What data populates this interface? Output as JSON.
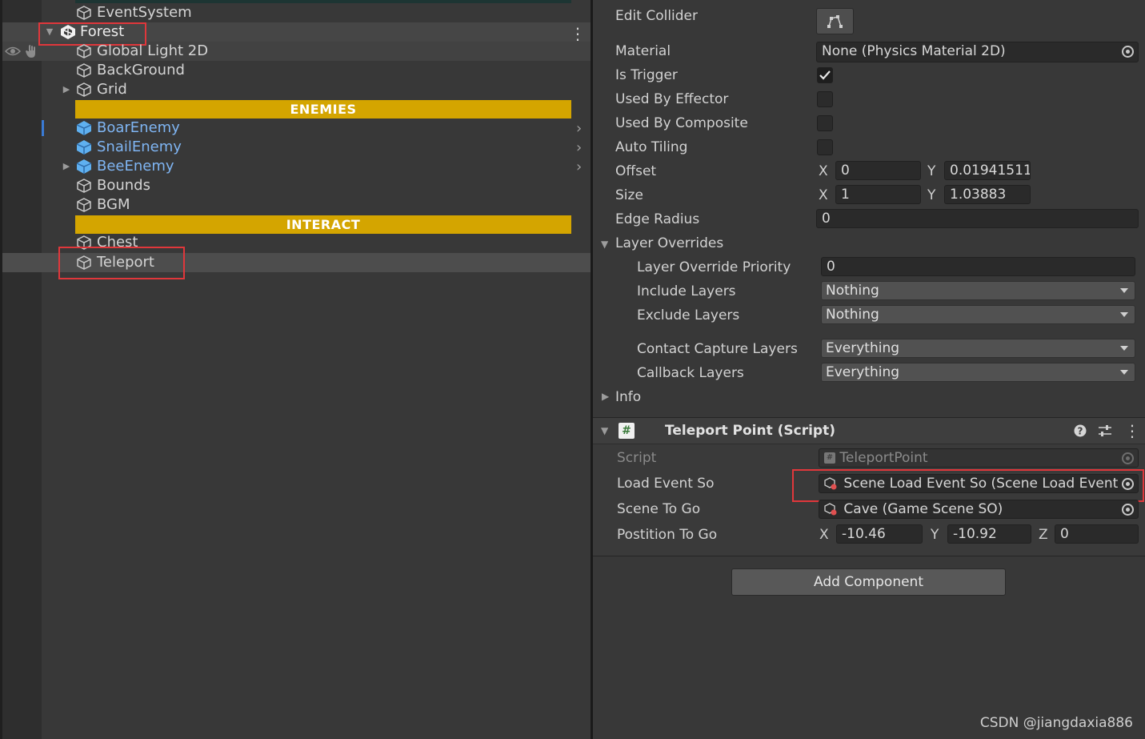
{
  "hierarchy": {
    "items": [
      {
        "label": "EventSystem"
      },
      {
        "label": "Forest"
      },
      {
        "label": "Global Light 2D"
      },
      {
        "label": "BackGround"
      },
      {
        "label": "Grid"
      },
      {
        "label": "BoarEnemy"
      },
      {
        "label": "SnailEnemy"
      },
      {
        "label": "BeeEnemy"
      },
      {
        "label": "Bounds"
      },
      {
        "label": "BGM"
      },
      {
        "label": "Chest"
      },
      {
        "label": "Teleport"
      }
    ],
    "separators": [
      "ENEMIES",
      "INTERACT"
    ],
    "menu_glyph": "⋮"
  },
  "inspector": {
    "collider": {
      "edit_collider_label": "Edit Collider",
      "material_label": "Material",
      "material_value": "None (Physics Material 2D)",
      "is_trigger_label": "Is Trigger",
      "is_trigger": true,
      "used_by_effector_label": "Used By Effector",
      "used_by_effector": false,
      "used_by_composite_label": "Used By Composite",
      "used_by_composite": false,
      "auto_tiling_label": "Auto Tiling",
      "auto_tiling": false,
      "offset_label": "Offset",
      "offset_x": "0",
      "offset_y": "0.01941511",
      "size_label": "Size",
      "size_x": "1",
      "size_y": "1.03883",
      "edge_radius_label": "Edge Radius",
      "edge_radius": "0",
      "layer_overrides_label": "Layer Overrides",
      "layer_override_priority_label": "Layer Override Priority",
      "layer_override_priority": "0",
      "include_layers_label": "Include Layers",
      "include_layers": "Nothing",
      "exclude_layers_label": "Exclude Layers",
      "exclude_layers": "Nothing",
      "contact_capture_label": "Contact Capture Layers",
      "contact_capture": "Everything",
      "callback_layers_label": "Callback Layers",
      "callback_layers": "Everything",
      "info_label": "Info"
    },
    "axes": {
      "x": "X",
      "y": "Y",
      "z": "Z"
    },
    "script_component": {
      "title": "Teleport Point (Script)",
      "script_label": "Script",
      "script_value": "TeleportPoint",
      "load_event_label": "Load Event So",
      "load_event_value": "Scene Load Event So (Scene Load Event",
      "scene_to_go_label": "Scene To Go",
      "scene_to_go_value": "Cave (Game Scene SO)",
      "position_label": "Postition To Go",
      "pos_x": "-10.46",
      "pos_y": "-10.92",
      "pos_z": "0"
    },
    "add_component_label": "Add Component"
  },
  "watermark": "CSDN @jiangdaxia886",
  "colors": {
    "separator_bar": "#d4a500",
    "prefab_text": "#7fb5f3",
    "highlight_box": "#e0373b",
    "panel_bg": "#383838"
  }
}
